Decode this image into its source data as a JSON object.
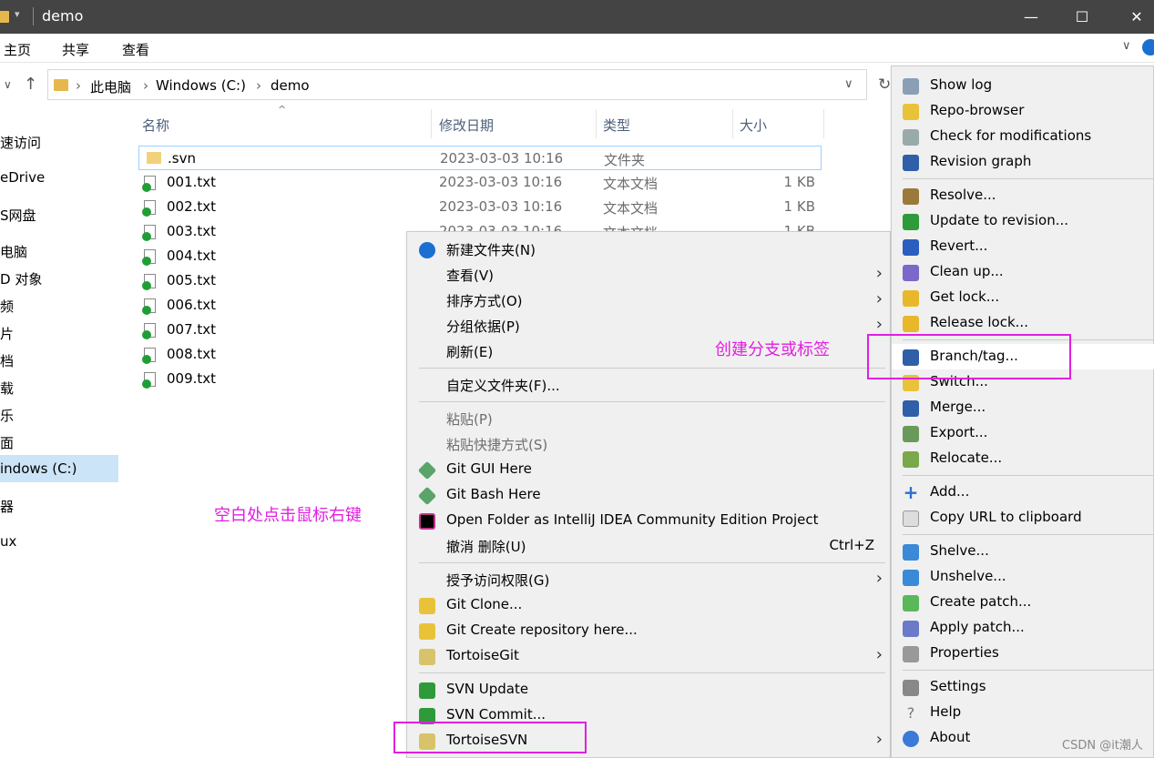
{
  "window": {
    "title": "demo",
    "minimize": "—",
    "maximize": "☐",
    "close": "✕"
  },
  "ribbon": {
    "tabs": [
      "主页",
      "共享",
      "查看"
    ]
  },
  "address": {
    "crumbs": [
      "此电脑",
      "Windows (C:)",
      "demo"
    ]
  },
  "nav": {
    "items": [
      "速访问",
      "eDrive",
      "S网盘",
      "电脑",
      "D 对象",
      "频",
      "片",
      "档",
      "载",
      "乐",
      "面",
      "indows  (C:)",
      "器",
      "ux"
    ]
  },
  "columns": [
    "名称",
    "修改日期",
    "类型",
    "大小"
  ],
  "files": [
    {
      "name": ".svn",
      "date": "2023-03-03 10:16",
      "type": "文件夹",
      "size": ""
    },
    {
      "name": "001.txt",
      "date": "2023-03-03 10:16",
      "type": "文本文档",
      "size": "1 KB"
    },
    {
      "name": "002.txt",
      "date": "2023-03-03 10:16",
      "type": "文本文档",
      "size": "1 KB"
    },
    {
      "name": "003.txt",
      "date": "2023-03-03 10:16",
      "type": "文本文档",
      "size": "1 KB"
    },
    {
      "name": "004.txt",
      "date": "",
      "type": "",
      "size": ""
    },
    {
      "name": "005.txt",
      "date": "",
      "type": "",
      "size": ""
    },
    {
      "name": "006.txt",
      "date": "",
      "type": "",
      "size": ""
    },
    {
      "name": "007.txt",
      "date": "",
      "type": "",
      "size": ""
    },
    {
      "name": "008.txt",
      "date": "",
      "type": "",
      "size": ""
    },
    {
      "name": "009.txt",
      "date": "",
      "type": "",
      "size": ""
    }
  ],
  "context_menu": {
    "new_folder": "新建文件夹(N)",
    "view": "查看(V)",
    "sort": "排序方式(O)",
    "group": "分组依据(P)",
    "refresh": "刷新(E)",
    "customize": "自定义文件夹(F)...",
    "paste": "粘贴(P)",
    "paste_shortcut": "粘贴快捷方式(S)",
    "git_gui": "Git GUI Here",
    "git_bash": "Git Bash Here",
    "intellij": "Open Folder as IntelliJ IDEA Community Edition Project",
    "undo": "撤消 删除(U)",
    "undo_shortcut": "Ctrl+Z",
    "grant": "授予访问权限(G)",
    "git_clone": "Git Clone...",
    "git_create": "Git Create repository here...",
    "tortoise_git": "TortoiseGit",
    "svn_update": "SVN Update",
    "svn_commit": "SVN Commit...",
    "tortoise_svn": "TortoiseSVN"
  },
  "svn_menu": {
    "show_log": "Show log",
    "repo_browser": "Repo-browser",
    "check_mod": "Check for modifications",
    "rev_graph": "Revision graph",
    "resolve": "Resolve...",
    "update_rev": "Update to revision...",
    "revert": "Revert...",
    "cleanup": "Clean up...",
    "get_lock": "Get lock...",
    "release_lock": "Release lock...",
    "branch_tag": "Branch/tag...",
    "switch": "Switch...",
    "merge": "Merge...",
    "export": "Export...",
    "relocate": "Relocate...",
    "add": "Add...",
    "copy_url": "Copy URL to clipboard",
    "shelve": "Shelve...",
    "unshelve": "Unshelve...",
    "create_patch": "Create patch...",
    "apply_patch": "Apply patch...",
    "properties": "Properties",
    "settings": "Settings",
    "help": "Help",
    "about": "About"
  },
  "annotations": {
    "branch": "创建分支或标签",
    "rightclick": "空白处点击鼠标右键"
  },
  "watermark": "CSDN @it潮人"
}
